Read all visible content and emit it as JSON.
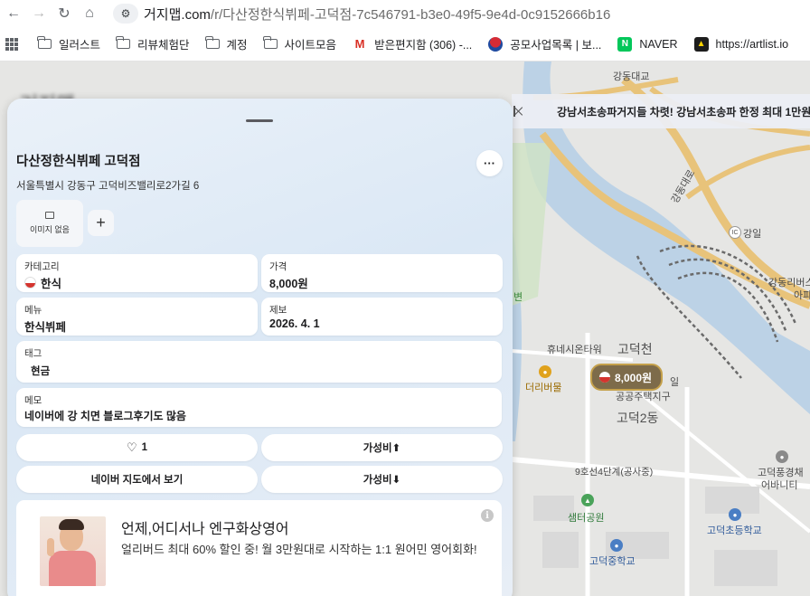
{
  "browser": {
    "url_host": "거지맵.com",
    "url_path": "/r/다산정한식뷔페-고덕점-7c546791-b3e0-49f5-9e4d-0c9152666b16",
    "icons": [
      "back-icon",
      "forward-icon",
      "reload-icon",
      "home-icon",
      "site-info-icon"
    ]
  },
  "bookmarks": [
    {
      "label": "일러스트",
      "icon": "folder-icon"
    },
    {
      "label": "리뷰체험단",
      "icon": "folder-icon"
    },
    {
      "label": "계정",
      "icon": "folder-icon"
    },
    {
      "label": "사이트모음",
      "icon": "folder-icon"
    },
    {
      "label": "받은편지함 (306) -...",
      "icon": "gmail-icon"
    },
    {
      "label": "공모사업목록 | 보...",
      "icon": "korea-gov-icon"
    },
    {
      "label": "NAVER",
      "icon": "naver-icon"
    },
    {
      "label": "https://artlist.io",
      "icon": "artlist-icon"
    }
  ],
  "background": {
    "site_title": "거지맵"
  },
  "map": {
    "banner_text": "강남서초송파거지들 차렷! 강남서초송파 한정 최대 1만원",
    "price_pin": "8,000원",
    "labels": {
      "gangdong_bridge": "강동대교",
      "hwinesion_tower": "휴네시온타워",
      "godeokcheon": "고덕천",
      "deoribeomul": "더리버물",
      "godeok2dong": "고덕2동",
      "gongeop_district": "공공주택지구",
      "line9_station": "9호선4단계(공사중)",
      "semteo_park": "샘터공원",
      "godeok_elem": "고덕초등학교",
      "godeok_middle": "고덕중학교",
      "gangil": "강일",
      "ic": "IC",
      "godeok_pung": "고덕풍경채",
      "aebeoniil": "어바니티",
      "gangdong_riv": "강동리버스",
      "apa": "아파",
      "road": "강동대로",
      "il": "일",
      "byeon": "변"
    }
  },
  "panel": {
    "title": "다산정한식뷔페 고덕점",
    "more_label": "···",
    "address": "서울특별시 강동구 고덕비즈밸리로2가길 6",
    "image_placeholder": "이미지 없음",
    "add_label": "+",
    "fields": {
      "category_key": "카테고리",
      "category_value": "한식",
      "price_key": "가격",
      "price_value": "8,000원",
      "menu_key": "메뉴",
      "menu_value": "한식뷔페",
      "report_key": "제보",
      "report_value": "2026. 4. 1",
      "tag_key": "태그",
      "tag_value": "현금",
      "memo_key": "메모",
      "memo_value": "네이버에 강 치면 블로그후기도 많음"
    },
    "buttons": {
      "like_count": "1",
      "value_up": "가성비⬆",
      "naver_map": "네이버 지도에서 보기",
      "value_down": "가성비⬇"
    },
    "ad": {
      "headline": "언제,어디서나 엔구화상영어",
      "body": "얼리버드 최대 60% 할인 중! 월 3만원대로 시작하는 1:1 원어민 영어회화!",
      "info": "i"
    }
  },
  "colors": {
    "panel_bg": "#dfeaf6",
    "card_bg": "#ffffff",
    "pin_bg": "#7d6b4a",
    "pin_border": "#c4a04a",
    "kimchi_red": "#d4342e"
  }
}
